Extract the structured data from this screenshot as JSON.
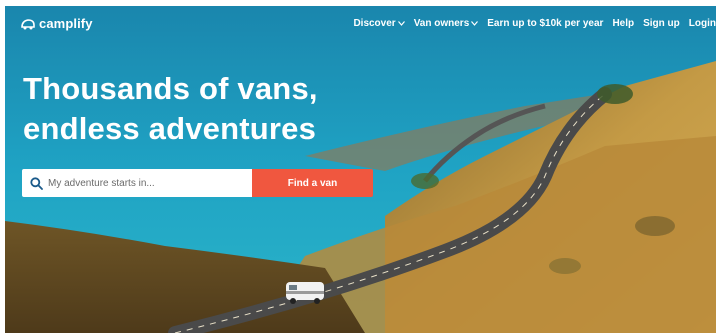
{
  "brand": {
    "name": "camplify",
    "logo_icon": "camper-van-icon"
  },
  "nav": {
    "items": [
      {
        "label": "Discover",
        "has_dropdown": true
      },
      {
        "label": "Van owners",
        "has_dropdown": true
      },
      {
        "label": "Earn up to $10k per year",
        "has_dropdown": false
      },
      {
        "label": "Help",
        "has_dropdown": false
      },
      {
        "label": "Sign up",
        "has_dropdown": false
      },
      {
        "label": "Login",
        "has_dropdown": false
      }
    ]
  },
  "hero": {
    "title_line1": "Thousands of vans,",
    "title_line2": "endless adventures"
  },
  "search": {
    "placeholder": "My adventure starts in...",
    "value": "",
    "icon": "search-icon",
    "button_label": "Find a van"
  },
  "colors": {
    "accent": "#f0573f",
    "lake": "#1a8fb8",
    "hillside": "#b88a3a",
    "road": "#4a4a4a"
  }
}
